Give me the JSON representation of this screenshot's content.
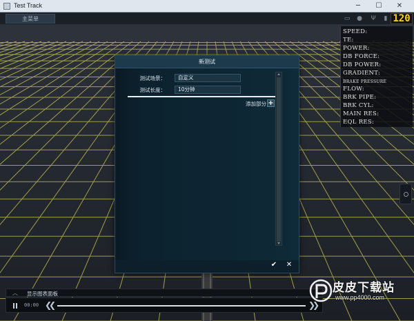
{
  "window": {
    "title": "Test Track",
    "min": "─",
    "max": "☐",
    "close": "✕"
  },
  "topbar": {
    "main_menu": "主菜单",
    "speed_display": "120"
  },
  "readout": {
    "rows": [
      "SPEED:",
      "TE:",
      "POWER:",
      "DB FORCE:",
      "DB POWER:",
      "GRADIENT:",
      "BRAKE PRESSURE",
      "FLOW:",
      "BRK PIPE:",
      "BRK CYL:",
      "MAIN RES:",
      "EQL RES:"
    ]
  },
  "dialog": {
    "title": "新测试",
    "scenario_label": "测试场景：",
    "scenario_value": "自定义",
    "length_label": "测试长度：",
    "length_value": "10分钟",
    "add_section": "添加部分",
    "add_icon": "+",
    "confirm_icon": "✔",
    "cancel_icon": "✕"
  },
  "bottom": {
    "chart_panel_label": "显示图表面板",
    "chevron": "︿",
    "time": "00:00",
    "rewind": "❮❮",
    "forward": "❯❯"
  },
  "watermark": {
    "title": "皮皮下载站",
    "url": "www.pp4000.com"
  },
  "colors": {
    "accent_yellow": "#ffd400",
    "dialog_bg": "#0d1f2b",
    "grid_line": "#c8c25a"
  }
}
